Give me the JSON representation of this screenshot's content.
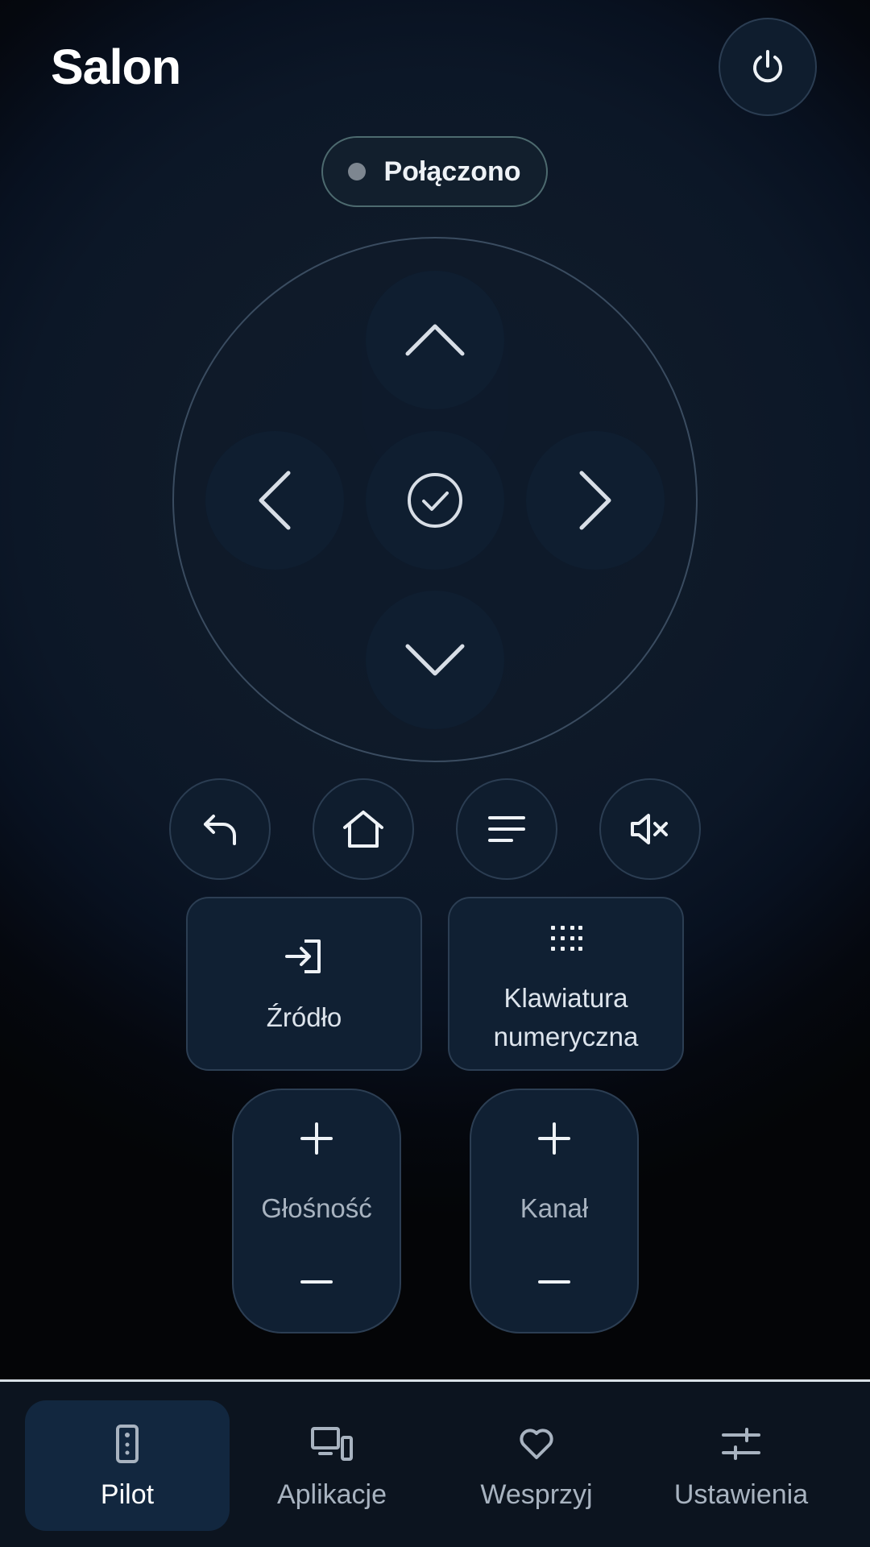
{
  "header": {
    "title": "Salon",
    "power_icon": "power-icon"
  },
  "status": {
    "label": "Połączono",
    "dot_color": "#7d8690"
  },
  "dpad": {
    "up_icon": "chevron-up-icon",
    "down_icon": "chevron-down-icon",
    "left_icon": "chevron-left-icon",
    "right_icon": "chevron-right-icon",
    "ok_icon": "check-circle-icon"
  },
  "quick_actions": [
    {
      "icon": "back-icon"
    },
    {
      "icon": "home-icon"
    },
    {
      "icon": "menu-icon"
    },
    {
      "icon": "mute-icon"
    }
  ],
  "cards": {
    "source": {
      "label": "Źródło",
      "icon": "input-icon"
    },
    "numpad": {
      "label_line1": "Klawiatura",
      "label_line2": "numeryczna",
      "icon": "dialpad-icon"
    }
  },
  "rockers": {
    "volume": {
      "label": "Głośność"
    },
    "channel": {
      "label": "Kanał"
    }
  },
  "nav": {
    "items": [
      {
        "label": "Pilot",
        "icon": "remote-icon",
        "active": true
      },
      {
        "label": "Aplikacje",
        "icon": "devices-icon",
        "active": false
      },
      {
        "label": "Wesprzyj",
        "icon": "heart-icon",
        "active": false
      },
      {
        "label": "Ustawienia",
        "icon": "sliders-icon",
        "active": false
      }
    ]
  },
  "colors": {
    "accent": "#12273f",
    "surface": "#102033",
    "border": "#2c3e53",
    "background": "#05070c"
  }
}
